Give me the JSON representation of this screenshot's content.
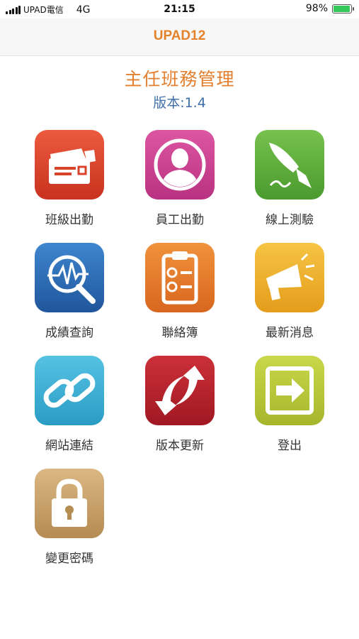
{
  "status_bar": {
    "carrier": "UPAD電信",
    "network": "4G",
    "time": "21:15",
    "battery": "98%",
    "battery_level": 0.98
  },
  "nav": {
    "title": "UPAD12"
  },
  "header": {
    "title": "主任班務管理",
    "version": "版本:1.4"
  },
  "menu": [
    {
      "label": "班級出勤",
      "icon": "attendance-card-icon",
      "color": "#d9432c"
    },
    {
      "label": "員工出勤",
      "icon": "person-icon",
      "color": "#c9418f"
    },
    {
      "label": "線上測驗",
      "icon": "fountain-pen-icon",
      "color": "#5fa93c"
    },
    {
      "label": "成績查詢",
      "icon": "magnifier-chart-icon",
      "color": "#2c6fb7"
    },
    {
      "label": "聯絡簿",
      "icon": "clipboard-icon",
      "color": "#e47d2e"
    },
    {
      "label": "最新消息",
      "icon": "megaphone-icon",
      "color": "#f0b52b"
    },
    {
      "label": "網站連結",
      "icon": "link-icon",
      "color": "#3db2d6"
    },
    {
      "label": "版本更新",
      "icon": "refresh-arrows-icon",
      "color": "#b8232c"
    },
    {
      "label": "登出",
      "icon": "exit-arrow-icon",
      "color": "#b9c93a"
    },
    {
      "label": "變更密碼",
      "icon": "padlock-icon",
      "color": "#c9a26a"
    }
  ]
}
